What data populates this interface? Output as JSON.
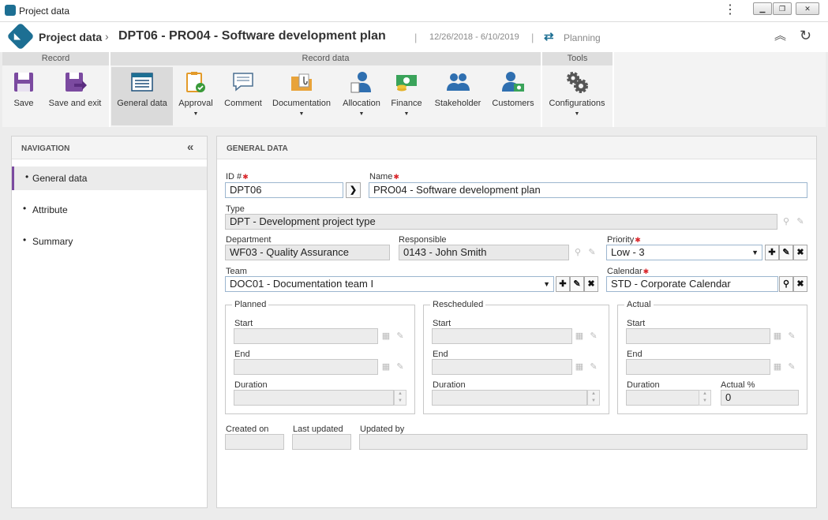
{
  "window": {
    "title": "Project data"
  },
  "header": {
    "breadcrumb_root": "Project data",
    "breadcrumb_sep": "›",
    "title": "DPT06 - PRO04 - Software development plan",
    "dates": "12/26/2018 - 6/10/2019",
    "planning_label": "Planning"
  },
  "ribbon": {
    "groups": {
      "record": "Record",
      "record_data": "Record data",
      "tools": "Tools"
    },
    "tools": {
      "save": "Save",
      "save_exit": "Save and exit",
      "general_data": "General data",
      "approval": "Approval",
      "comment": "Comment",
      "documentation": "Documentation",
      "allocation": "Allocation",
      "finance": "Finance",
      "stakeholder": "Stakeholder",
      "customers": "Customers",
      "configurations": "Configurations"
    }
  },
  "navigation": {
    "title": "NAVIGATION",
    "items": [
      "General data",
      "Attribute",
      "Summary"
    ]
  },
  "form": {
    "title": "GENERAL DATA",
    "id": {
      "label": "ID #",
      "value": "DPT06"
    },
    "name": {
      "label": "Name",
      "value": "PRO04 - Software development plan"
    },
    "type": {
      "label": "Type",
      "value": "DPT - Development project type"
    },
    "department": {
      "label": "Department",
      "value": "WF03 - Quality Assurance"
    },
    "responsible": {
      "label": "Responsible",
      "value": "0143 - John Smith"
    },
    "priority": {
      "label": "Priority",
      "value": "Low - 3"
    },
    "team": {
      "label": "Team",
      "value": "DOC01 - Documentation team I"
    },
    "calendar": {
      "label": "Calendar",
      "value": "STD - Corporate Calendar"
    },
    "planned": {
      "legend": "Planned",
      "start": "Start",
      "end": "End",
      "duration": "Duration"
    },
    "rescheduled": {
      "legend": "Rescheduled",
      "start": "Start",
      "end": "End",
      "duration": "Duration"
    },
    "actual": {
      "legend": "Actual",
      "start": "Start",
      "end": "End",
      "duration": "Duration",
      "actual_pct_label": "Actual %",
      "actual_pct_value": "0"
    },
    "created_on": {
      "label": "Created on",
      "value": ""
    },
    "last_updated": {
      "label": "Last updated",
      "value": ""
    },
    "updated_by": {
      "label": "Updated by",
      "value": ""
    }
  },
  "colors": {
    "brand": "#1d6f93",
    "active_nav": "#7b4aa0",
    "required": "#d9262b"
  }
}
